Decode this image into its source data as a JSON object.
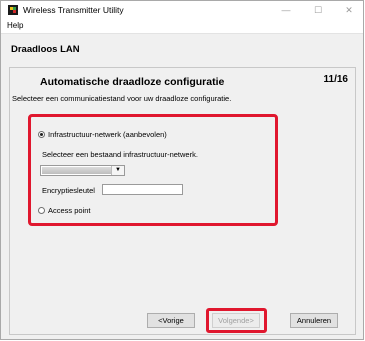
{
  "window": {
    "title": "Wireless Transmitter Utility",
    "controls": [
      "—",
      "☐",
      "✕"
    ]
  },
  "menu": {
    "help": "Help"
  },
  "header": {
    "title": "Draadloos LAN"
  },
  "step": {
    "title": "Automatische draadloze configuratie",
    "count": "11/16",
    "subtitle": "Selecteer een communicatiestand voor uw draadloze configuratie."
  },
  "options": {
    "infrastructure_label": "Infrastructuur-netwerk (aanbevolen)",
    "infrastructure_selected": true,
    "select_network_label": "Selecteer een bestaand infrastructuur-netwerk.",
    "network_value": "",
    "encryption_label": "Encryptiesleutel",
    "encryption_value": "",
    "access_point_label": "Access point"
  },
  "buttons": {
    "back": "<Vorige",
    "next": "Volgende>",
    "cancel": "Annuleren"
  },
  "colors": {
    "highlight": "#e0172e"
  }
}
